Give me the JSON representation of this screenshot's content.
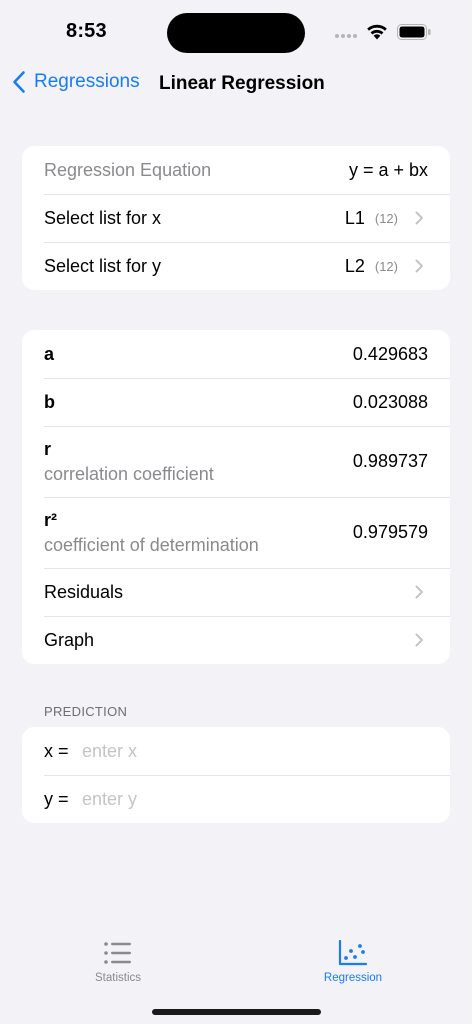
{
  "status_bar": {
    "time": "8:53"
  },
  "nav": {
    "back_label": "Regressions",
    "title": "Linear Regression"
  },
  "setup": {
    "equation_label": "Regression Equation",
    "equation_value": "y = a + bx",
    "x_label": "Select list for x",
    "x_list": "L1",
    "x_count": "(12)",
    "y_label": "Select list for y",
    "y_list": "L2",
    "y_count": "(12)"
  },
  "results": {
    "a_label": "a",
    "a_value": "0.429683",
    "b_label": "b",
    "b_value": "0.023088",
    "r_label": "r",
    "r_sub": "correlation coefficient",
    "r_value": "0.989737",
    "r2_label": "r²",
    "r2_sub": "coefficient of determination",
    "r2_value": "0.979579",
    "residuals_label": "Residuals",
    "graph_label": "Graph"
  },
  "prediction": {
    "header": "PREDICTION",
    "x_label": "x =",
    "x_placeholder": "enter x",
    "y_label": "y =",
    "y_placeholder": "enter y"
  },
  "tabs": [
    {
      "label": "Statistics",
      "icon": "list-icon",
      "active": false
    },
    {
      "label": "Regression",
      "icon": "scatter-icon",
      "active": true
    }
  ],
  "colors": {
    "accent": "#1a7cf3",
    "background": "#f2f2f7",
    "secondary_text": "#8a8a8e"
  }
}
